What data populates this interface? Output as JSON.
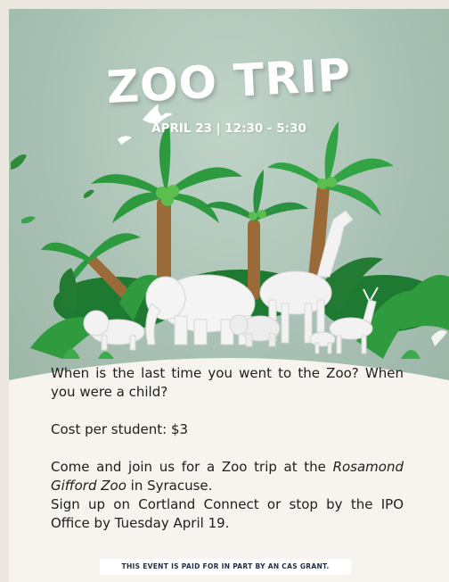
{
  "event": {
    "title": "ZOO TRIP",
    "date_time": "APRIL 23 | 12:30 - 5:30"
  },
  "body": {
    "question": "When is the last time you went to the Zoo? When you were a child?",
    "cost": "Cost per student: $3",
    "invite_prefix": "Come and join us for a Zoo trip at the ",
    "zoo_name": "Rosamond Gifford Zoo",
    "invite_suffix": " in Syracuse.",
    "signup": "Sign up on Cortland Connect or stop by the IPO Office by Tuesday April 19."
  },
  "footer": {
    "grant_note": "THIS EVENT IS PAID FOR IN PART BY AN CAS GRANT."
  },
  "colors": {
    "background": "#a8c0b3",
    "paper": "#f7f3ee",
    "foliage": "#2e9a3f",
    "animals": "#f4f4f4",
    "text": "#202020",
    "grant_text": "#1f2e46"
  },
  "illustration": {
    "icons": [
      "palm-tree-icon",
      "giraffe-icon",
      "elephant-icon",
      "lion-icon",
      "deer-icon",
      "bird-icon"
    ]
  }
}
